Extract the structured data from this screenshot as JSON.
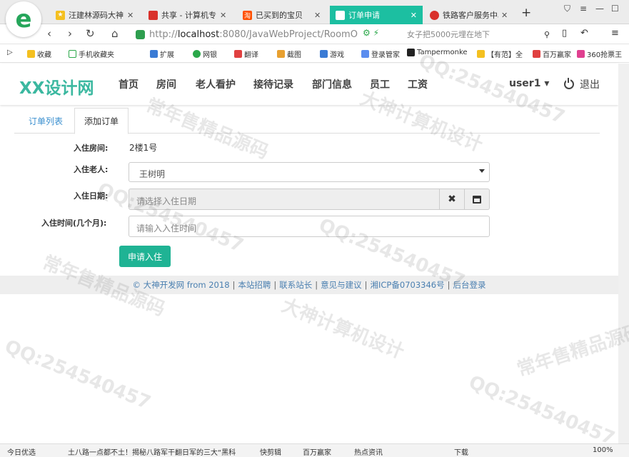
{
  "browser": {
    "tabs": [
      {
        "title": "汪建林源码大神",
        "fav_color": "#f4c020"
      },
      {
        "title": "共享 - 计算机专",
        "fav_color": "#d9312b"
      },
      {
        "title": "已买到的宝贝",
        "fav_color": "#ff5000"
      },
      {
        "title": "订单申请",
        "fav_color": "#1cbfa1"
      },
      {
        "title": "铁路客户服务中心",
        "fav_color": "#d9312b"
      }
    ],
    "url_scheme": "http://",
    "url_host": "localhost",
    "url_rest": ":8080/JavaWebProject/RoomO",
    "search_text": "女子把5000元埋在地下",
    "bookmarks": [
      "收藏",
      "手机收藏夹",
      "扩展",
      "网银",
      "翻译",
      "截图",
      "游戏",
      "登录管家",
      "Tampermonke",
      "【有范】全",
      "百万赢家",
      "360抢票王"
    ]
  },
  "site": {
    "brand": "XX设计网",
    "nav": [
      "首页",
      "房间",
      "老人看护",
      "接待记录",
      "部门信息",
      "员工",
      "工资"
    ],
    "user": "user1 ▾",
    "logout": "退出"
  },
  "tabs": {
    "list": "订单列表",
    "add": "添加订单"
  },
  "form": {
    "room_label": "入住房间:",
    "room_value": "2楼1号",
    "elder_label": "入住老人:",
    "elder_value": "王树明",
    "date_label": "入住日期:",
    "date_placeholder": "请选择入住日期",
    "months_label": "入住时间(几个月):",
    "months_placeholder": "请输入入住时间",
    "submit": "申请入住"
  },
  "footer": {
    "copyright": "© 大神开发网 from 2018",
    "links": [
      "本站招聘",
      "联系站长",
      "意见与建议",
      "湘ICP备0703346号",
      "后台登录"
    ]
  },
  "statusbar": {
    "left": "今日优选",
    "news": "土八路一点都不土！揭秘八路军干翻日军的三大“黑科",
    "items": [
      "快剪辑",
      "百万赢家",
      "热点资讯",
      "下载"
    ],
    "zoom": "100%"
  },
  "watermarks": [
    "常年售精品源码",
    "大神计算机设计",
    "QQ:254540457"
  ]
}
